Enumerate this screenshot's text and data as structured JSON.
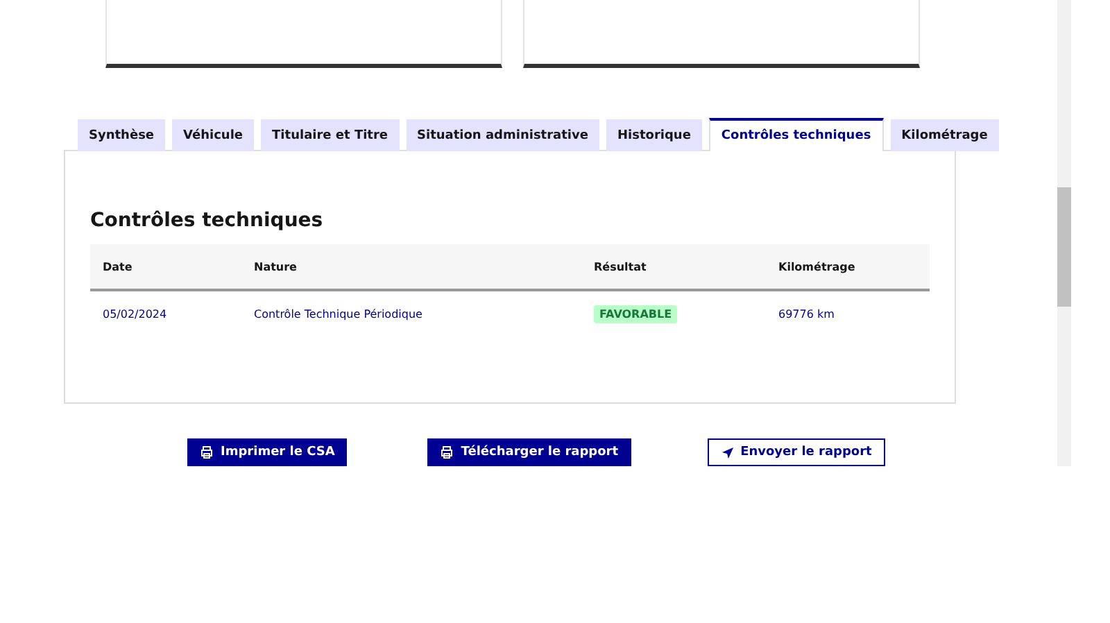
{
  "cards": [
    {
      "kind": "summary"
    },
    {
      "kind": "summary"
    }
  ],
  "tabs": [
    {
      "label": "Synthèse",
      "selected": false
    },
    {
      "label": "Véhicule",
      "selected": false
    },
    {
      "label": "Titulaire et Titre",
      "selected": false
    },
    {
      "label": "Situation administrative",
      "selected": false
    },
    {
      "label": "Historique",
      "selected": false
    },
    {
      "label": "Contrôles techniques",
      "selected": true
    },
    {
      "label": "Kilométrage",
      "selected": false
    }
  ],
  "panel": {
    "title": "Contrôles techniques",
    "table": {
      "columns": [
        "Date",
        "Nature",
        "Résultat",
        "Kilométrage"
      ],
      "rows": [
        {
          "date": "05/02/2024",
          "nature": "Contrôle Technique Périodique",
          "result": "FAVORABLE",
          "mileage": "69776 km"
        }
      ]
    }
  },
  "buttons": [
    {
      "label": "Imprimer le CSA",
      "kind": "primary"
    },
    {
      "label": "Télécharger le rapport",
      "kind": "primary"
    },
    {
      "label": "Envoyer le rapport",
      "kind": "secondary"
    }
  ]
}
